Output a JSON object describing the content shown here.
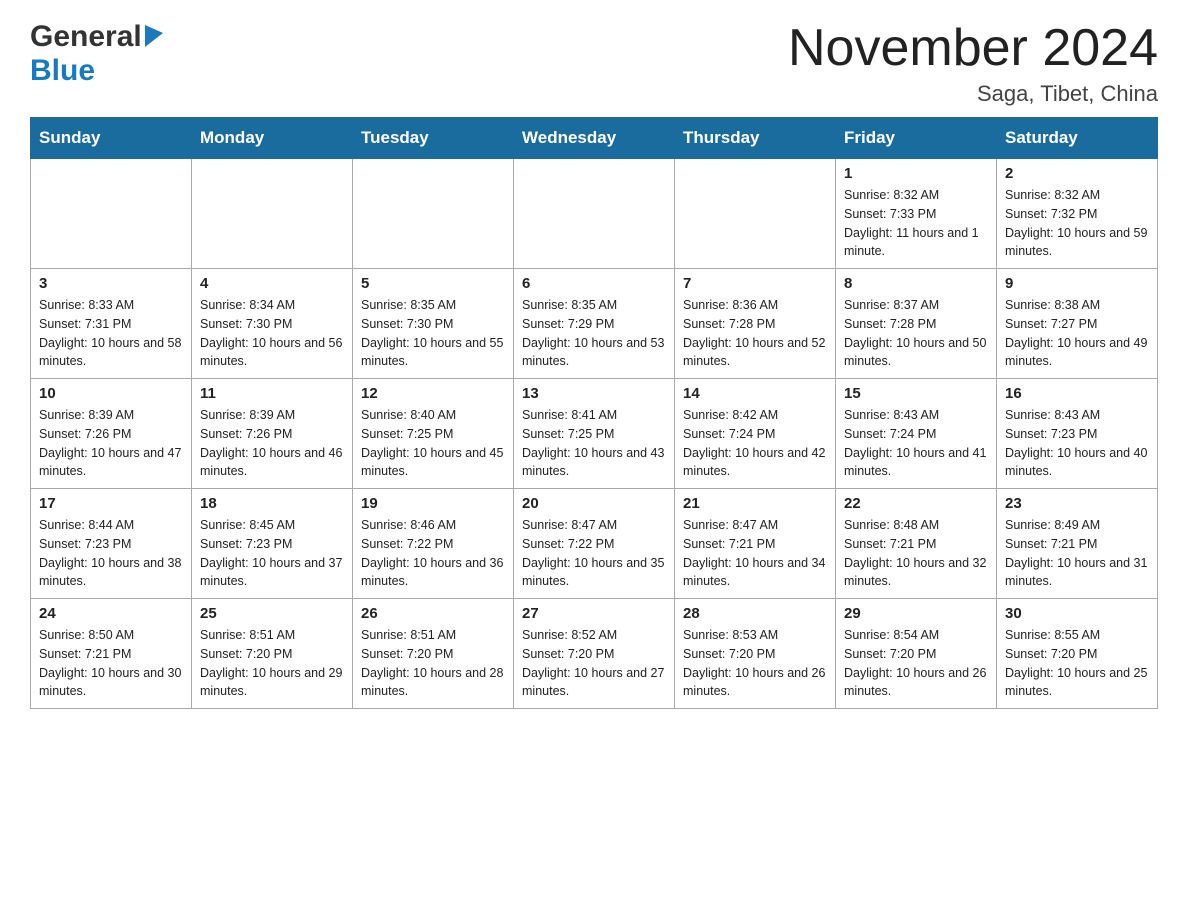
{
  "header": {
    "logo_general": "General",
    "logo_blue": "Blue",
    "title": "November 2024",
    "subtitle": "Saga, Tibet, China"
  },
  "days_of_week": [
    "Sunday",
    "Monday",
    "Tuesday",
    "Wednesday",
    "Thursday",
    "Friday",
    "Saturday"
  ],
  "weeks": [
    {
      "days": [
        {
          "date": "",
          "info": ""
        },
        {
          "date": "",
          "info": ""
        },
        {
          "date": "",
          "info": ""
        },
        {
          "date": "",
          "info": ""
        },
        {
          "date": "",
          "info": ""
        },
        {
          "date": "1",
          "info": "Sunrise: 8:32 AM\nSunset: 7:33 PM\nDaylight: 11 hours and 1 minute."
        },
        {
          "date": "2",
          "info": "Sunrise: 8:32 AM\nSunset: 7:32 PM\nDaylight: 10 hours and 59 minutes."
        }
      ]
    },
    {
      "days": [
        {
          "date": "3",
          "info": "Sunrise: 8:33 AM\nSunset: 7:31 PM\nDaylight: 10 hours and 58 minutes."
        },
        {
          "date": "4",
          "info": "Sunrise: 8:34 AM\nSunset: 7:30 PM\nDaylight: 10 hours and 56 minutes."
        },
        {
          "date": "5",
          "info": "Sunrise: 8:35 AM\nSunset: 7:30 PM\nDaylight: 10 hours and 55 minutes."
        },
        {
          "date": "6",
          "info": "Sunrise: 8:35 AM\nSunset: 7:29 PM\nDaylight: 10 hours and 53 minutes."
        },
        {
          "date": "7",
          "info": "Sunrise: 8:36 AM\nSunset: 7:28 PM\nDaylight: 10 hours and 52 minutes."
        },
        {
          "date": "8",
          "info": "Sunrise: 8:37 AM\nSunset: 7:28 PM\nDaylight: 10 hours and 50 minutes."
        },
        {
          "date": "9",
          "info": "Sunrise: 8:38 AM\nSunset: 7:27 PM\nDaylight: 10 hours and 49 minutes."
        }
      ]
    },
    {
      "days": [
        {
          "date": "10",
          "info": "Sunrise: 8:39 AM\nSunset: 7:26 PM\nDaylight: 10 hours and 47 minutes."
        },
        {
          "date": "11",
          "info": "Sunrise: 8:39 AM\nSunset: 7:26 PM\nDaylight: 10 hours and 46 minutes."
        },
        {
          "date": "12",
          "info": "Sunrise: 8:40 AM\nSunset: 7:25 PM\nDaylight: 10 hours and 45 minutes."
        },
        {
          "date": "13",
          "info": "Sunrise: 8:41 AM\nSunset: 7:25 PM\nDaylight: 10 hours and 43 minutes."
        },
        {
          "date": "14",
          "info": "Sunrise: 8:42 AM\nSunset: 7:24 PM\nDaylight: 10 hours and 42 minutes."
        },
        {
          "date": "15",
          "info": "Sunrise: 8:43 AM\nSunset: 7:24 PM\nDaylight: 10 hours and 41 minutes."
        },
        {
          "date": "16",
          "info": "Sunrise: 8:43 AM\nSunset: 7:23 PM\nDaylight: 10 hours and 40 minutes."
        }
      ]
    },
    {
      "days": [
        {
          "date": "17",
          "info": "Sunrise: 8:44 AM\nSunset: 7:23 PM\nDaylight: 10 hours and 38 minutes."
        },
        {
          "date": "18",
          "info": "Sunrise: 8:45 AM\nSunset: 7:23 PM\nDaylight: 10 hours and 37 minutes."
        },
        {
          "date": "19",
          "info": "Sunrise: 8:46 AM\nSunset: 7:22 PM\nDaylight: 10 hours and 36 minutes."
        },
        {
          "date": "20",
          "info": "Sunrise: 8:47 AM\nSunset: 7:22 PM\nDaylight: 10 hours and 35 minutes."
        },
        {
          "date": "21",
          "info": "Sunrise: 8:47 AM\nSunset: 7:21 PM\nDaylight: 10 hours and 34 minutes."
        },
        {
          "date": "22",
          "info": "Sunrise: 8:48 AM\nSunset: 7:21 PM\nDaylight: 10 hours and 32 minutes."
        },
        {
          "date": "23",
          "info": "Sunrise: 8:49 AM\nSunset: 7:21 PM\nDaylight: 10 hours and 31 minutes."
        }
      ]
    },
    {
      "days": [
        {
          "date": "24",
          "info": "Sunrise: 8:50 AM\nSunset: 7:21 PM\nDaylight: 10 hours and 30 minutes."
        },
        {
          "date": "25",
          "info": "Sunrise: 8:51 AM\nSunset: 7:20 PM\nDaylight: 10 hours and 29 minutes."
        },
        {
          "date": "26",
          "info": "Sunrise: 8:51 AM\nSunset: 7:20 PM\nDaylight: 10 hours and 28 minutes."
        },
        {
          "date": "27",
          "info": "Sunrise: 8:52 AM\nSunset: 7:20 PM\nDaylight: 10 hours and 27 minutes."
        },
        {
          "date": "28",
          "info": "Sunrise: 8:53 AM\nSunset: 7:20 PM\nDaylight: 10 hours and 26 minutes."
        },
        {
          "date": "29",
          "info": "Sunrise: 8:54 AM\nSunset: 7:20 PM\nDaylight: 10 hours and 26 minutes."
        },
        {
          "date": "30",
          "info": "Sunrise: 8:55 AM\nSunset: 7:20 PM\nDaylight: 10 hours and 25 minutes."
        }
      ]
    }
  ]
}
